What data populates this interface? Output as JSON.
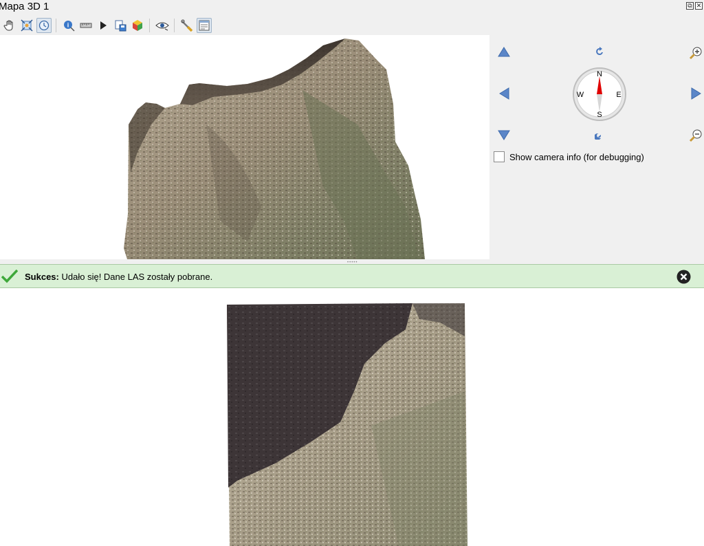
{
  "window": {
    "title": "Mapa 3D 1",
    "restore_icon": "restore-icon",
    "close_icon": "close-icon"
  },
  "toolbar": {
    "items": [
      {
        "name": "pan-tool",
        "icon": "hand-icon",
        "checked": false
      },
      {
        "name": "zoom-full-tool",
        "icon": "zoom-full-icon",
        "checked": false
      },
      {
        "name": "camera-control-tool",
        "icon": "camera-rotate-icon",
        "checked": true
      },
      {
        "name": "identify-tool",
        "icon": "identify-icon",
        "checked": false
      },
      {
        "name": "measure-tool",
        "icon": "measure-line-icon",
        "checked": false
      },
      {
        "name": "animation-tool",
        "icon": "play-icon",
        "checked": false
      },
      {
        "name": "export-tool",
        "icon": "save-scene-icon",
        "checked": false
      },
      {
        "name": "effects-tool",
        "icon": "cube-icon",
        "checked": false
      },
      {
        "name": "camera-view-tool",
        "icon": "eye-icon",
        "checked": false
      },
      {
        "name": "options-tool",
        "icon": "wrench-icon",
        "checked": false
      },
      {
        "name": "navigation-widget-tool",
        "icon": "navigation-panel-icon",
        "checked": true
      }
    ]
  },
  "navigation": {
    "compass": {
      "north": "N",
      "south": "S",
      "east": "E",
      "west": "W"
    },
    "show_camera_info_label": "Show camera info (for debugging)",
    "show_camera_info_checked": false
  },
  "message_bar": {
    "title": "Sukces:",
    "text": "Udało się! Dane LAS zostały pobrane.",
    "level": "success",
    "color": "#d9f0d5"
  },
  "colors": {
    "panel_bg": "#f0f0f0",
    "nav_arrow": "#5b86c8",
    "compass_needle": "#e00000"
  }
}
